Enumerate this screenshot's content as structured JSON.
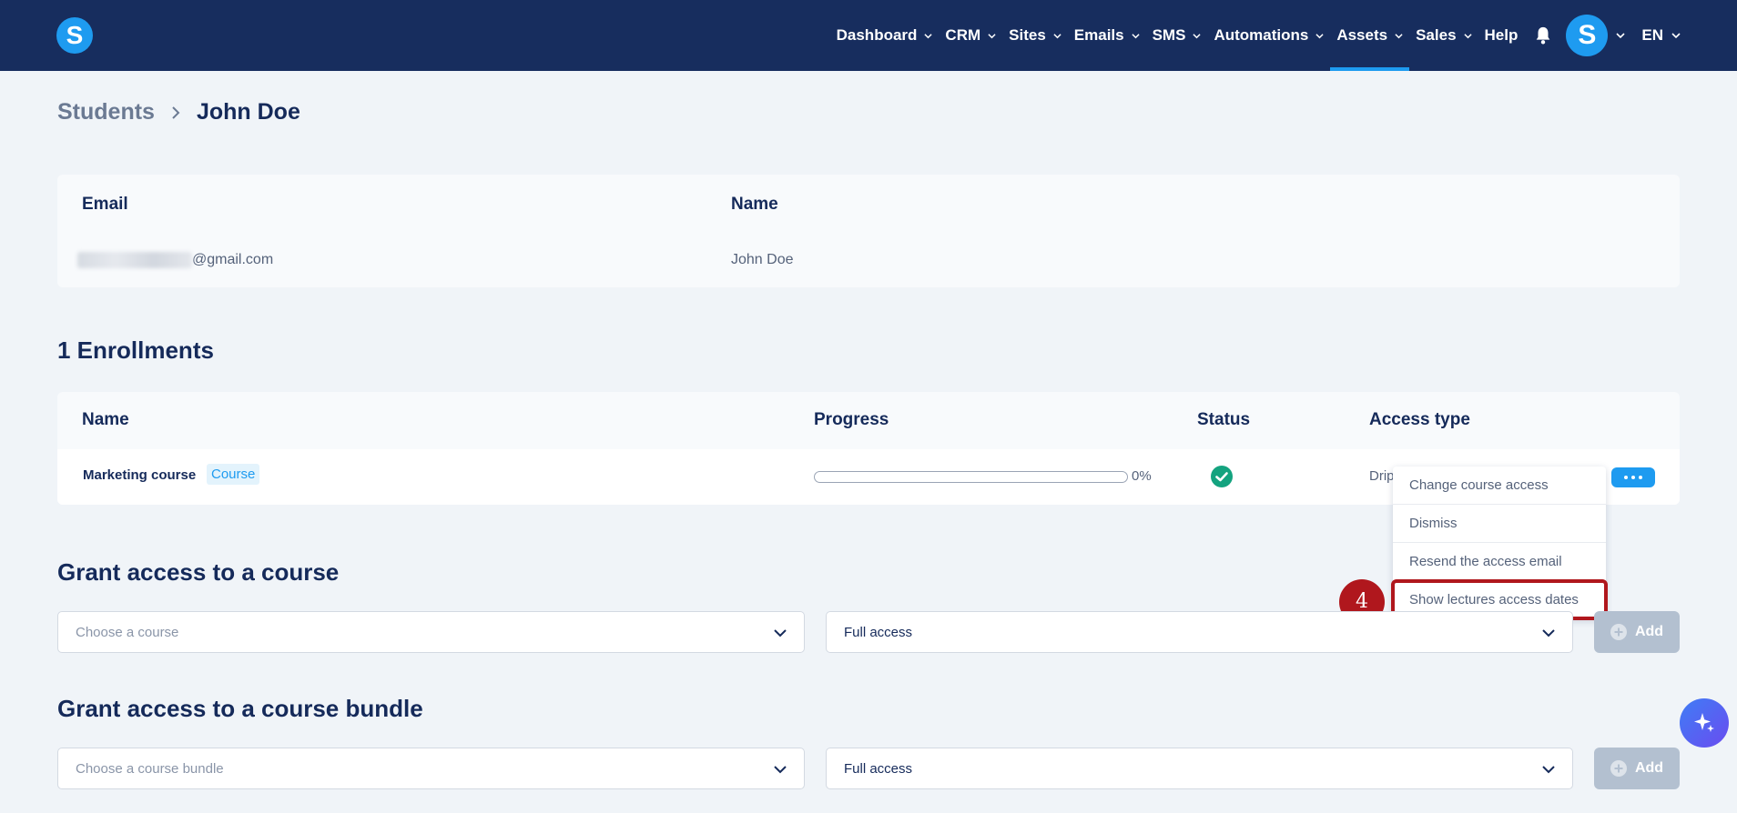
{
  "nav": {
    "logo_letter": "S",
    "items": [
      {
        "label": "Dashboard"
      },
      {
        "label": "CRM"
      },
      {
        "label": "Sites"
      },
      {
        "label": "Emails"
      },
      {
        "label": "SMS"
      },
      {
        "label": "Automations"
      },
      {
        "label": "Assets",
        "active": true
      },
      {
        "label": "Sales"
      }
    ],
    "help_label": "Help",
    "avatar_letter": "S",
    "language": "EN",
    "icons": {
      "bell": "bell-icon",
      "chevron": "chevron-down-icon"
    }
  },
  "breadcrumb": {
    "parent": "Students",
    "current": "John Doe"
  },
  "student": {
    "email_label": "Email",
    "name_label": "Name",
    "email_visible_part": "@gmail.com",
    "name": "John Doe"
  },
  "enrollments": {
    "title": "1 Enrollments",
    "columns": {
      "name": "Name",
      "progress": "Progress",
      "status": "Status",
      "access_type": "Access type"
    },
    "rows": [
      {
        "name": "Marketing course",
        "tag": "Course",
        "progress_pct": 0,
        "progress_label": "0%",
        "status": "complete",
        "access_type": "Drip"
      }
    ]
  },
  "row_menu": {
    "items": [
      {
        "label": "Change course access"
      },
      {
        "label": "Dismiss"
      },
      {
        "label": "Resend the access email"
      },
      {
        "label": "Show lectures access dates",
        "highlighted": true
      }
    ],
    "step_number": "4"
  },
  "grant_course": {
    "title": "Grant access to a course",
    "course_placeholder": "Choose a course",
    "access_value": "Full access",
    "add_label": "Add"
  },
  "grant_bundle": {
    "title": "Grant access to a course bundle",
    "bundle_placeholder": "Choose a course bundle",
    "access_value": "Full access",
    "add_label": "Add"
  },
  "colors": {
    "nav_bg": "#172d5e",
    "accent": "#1e9bf0",
    "success": "#14a37f",
    "highlight": "#b0171d",
    "disabled_button": "#b3c0d0"
  }
}
